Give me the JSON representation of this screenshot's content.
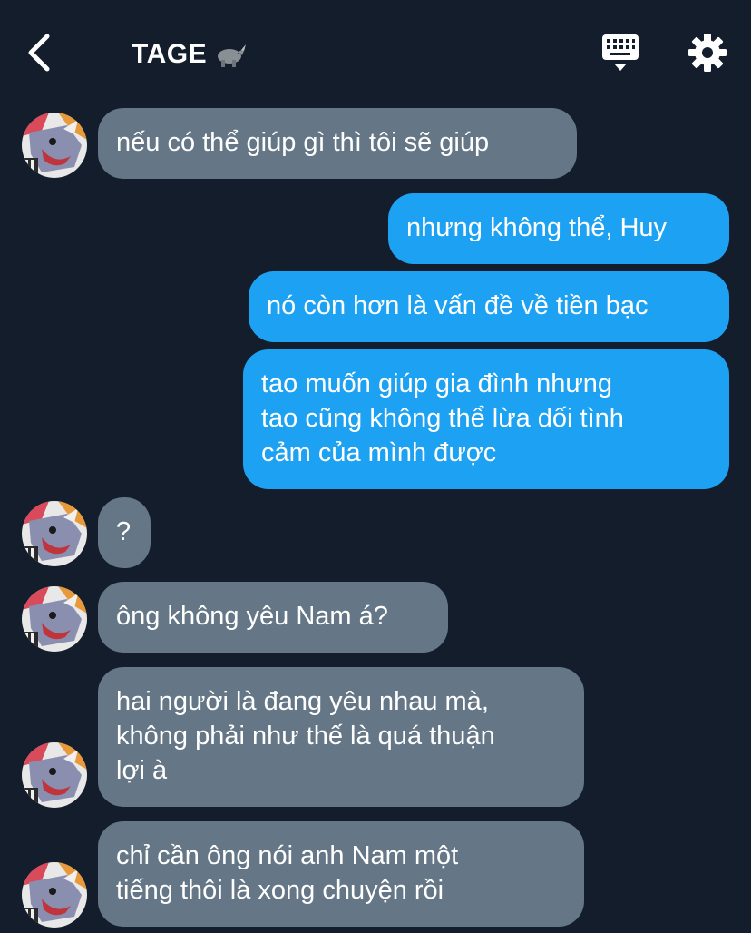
{
  "header": {
    "title": "TAGE",
    "title_emoji": "rhino-emoji",
    "back_icon": "chevron-left-icon",
    "keyboard_icon": "keyboard-icon",
    "settings_icon": "gear-icon"
  },
  "colors": {
    "background": "#141d2b",
    "incoming_bubble": "#657786",
    "outgoing_bubble": "#1da1f2",
    "text": "#ffffff"
  },
  "messages": [
    {
      "direction": "incoming",
      "text": "nếu có thể giúp gì thì tôi sẽ giúp",
      "avatar": true
    },
    {
      "direction": "outgoing",
      "text": "nhưng không thể, Huy"
    },
    {
      "direction": "outgoing",
      "text": "nó còn hơn là vấn đề về tiền bạc"
    },
    {
      "direction": "outgoing",
      "text": "tao muốn giúp gia đình nhưng\ntao cũng không thể lừa dối tình\ncảm của mình được"
    },
    {
      "direction": "incoming",
      "text": "?",
      "avatar": true
    },
    {
      "direction": "incoming",
      "text": "ông không yêu Nam á?",
      "avatar": true
    },
    {
      "direction": "incoming",
      "text": "hai người là đang yêu nhau mà,\nkhông phải như thế là quá thuận\nlợi à",
      "avatar": true
    },
    {
      "direction": "incoming",
      "text": "chỉ cần ông nói anh Nam một\ntiếng thôi là xong chuyện rồi",
      "avatar": true
    }
  ]
}
